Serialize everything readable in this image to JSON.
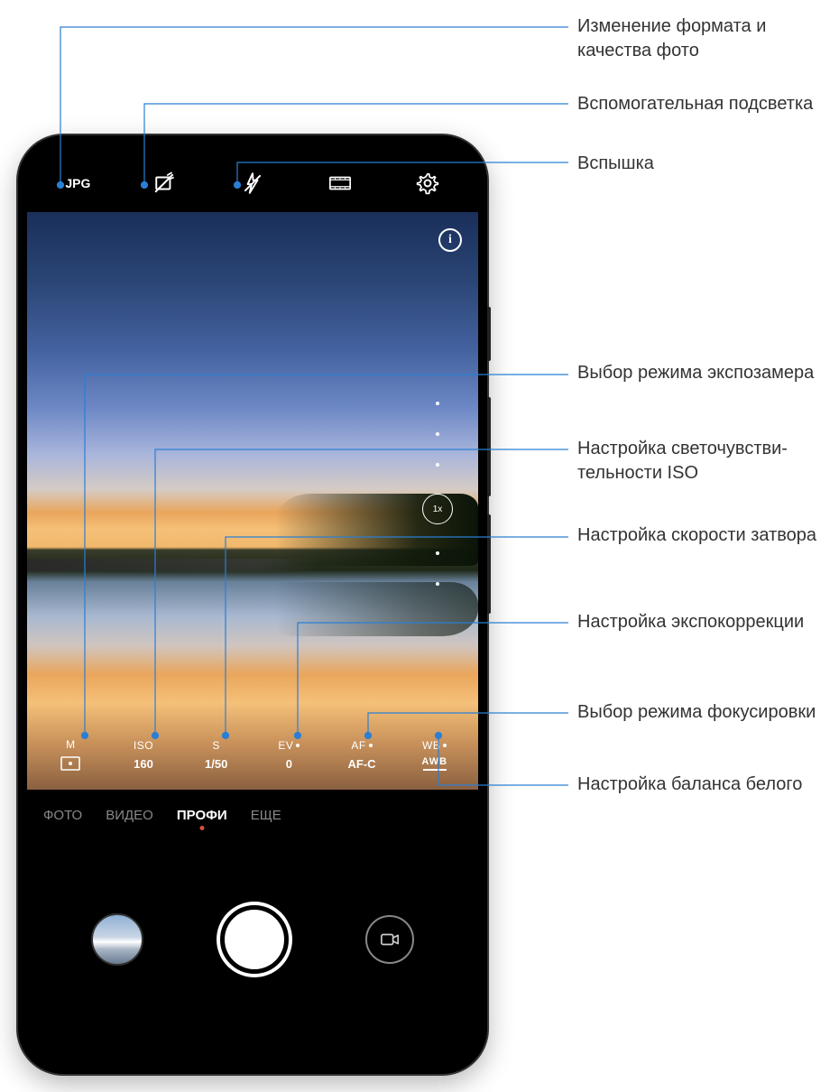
{
  "top_bar": {
    "format": "JPG"
  },
  "zoom": {
    "level": "1x"
  },
  "pro": {
    "metering": {
      "label": "M",
      "value_icon": "matrix"
    },
    "iso": {
      "label": "ISO",
      "value": "160"
    },
    "shutter": {
      "label": "S",
      "value": "1/50"
    },
    "ev": {
      "label": "EV",
      "value": "0"
    },
    "af": {
      "label": "AF",
      "value": "AF-C"
    },
    "wb": {
      "label": "WB",
      "value": "AWB"
    }
  },
  "modes": {
    "photo": "ФОТО",
    "video": "ВИДЕО",
    "pro": "ПРОФИ",
    "more": "ЕЩЕ"
  },
  "callouts": {
    "format": "Изменение формата и качества фото",
    "assist": "Вспомогательная подсветка",
    "flash": "Вспышка",
    "metering": "Выбор режима экспозамера",
    "iso": "Настройка светочувстви­тельности ISO",
    "shutter": "Настройка скорости затвора",
    "ev": "Настройка экспокоррекции",
    "af": "Выбор режима фокусировки",
    "wb": "Настройка баланса белого"
  }
}
